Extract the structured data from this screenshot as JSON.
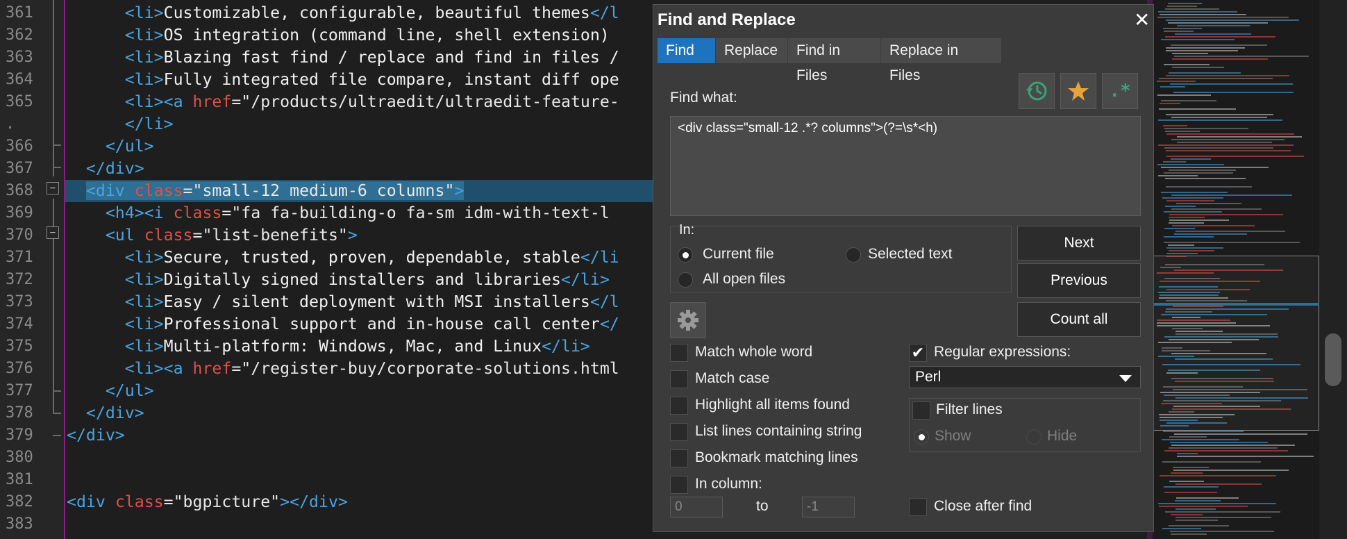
{
  "editor": {
    "line_numbers": [
      "361",
      "362",
      "363",
      "364",
      "365",
      ".",
      "366",
      "367",
      "368",
      "369",
      "370",
      "371",
      "372",
      "373",
      "374",
      "375",
      "376",
      "377",
      "378",
      "379",
      "380",
      "381",
      "382",
      "383"
    ],
    "lines": [
      {
        "num": "361",
        "segments": [
          {
            "t": "      ",
            "c": "txt"
          },
          {
            "t": "<li>",
            "c": "tag"
          },
          {
            "t": "Customizable, configurable, beautiful themes",
            "c": "txt"
          },
          {
            "t": "</l",
            "c": "tag"
          }
        ]
      },
      {
        "num": "362",
        "segments": [
          {
            "t": "      ",
            "c": "txt"
          },
          {
            "t": "<li>",
            "c": "tag"
          },
          {
            "t": "OS integration (command line, shell extension)",
            "c": "txt"
          }
        ]
      },
      {
        "num": "363",
        "segments": [
          {
            "t": "      ",
            "c": "txt"
          },
          {
            "t": "<li>",
            "c": "tag"
          },
          {
            "t": "Blazing fast find / replace and find in files /",
            "c": "txt"
          }
        ]
      },
      {
        "num": "364",
        "segments": [
          {
            "t": "      ",
            "c": "txt"
          },
          {
            "t": "<li>",
            "c": "tag"
          },
          {
            "t": "Fully integrated file compare, instant diff ope",
            "c": "txt"
          }
        ]
      },
      {
        "num": "365",
        "segments": [
          {
            "t": "      ",
            "c": "txt"
          },
          {
            "t": "<li><a ",
            "c": "tag"
          },
          {
            "t": "href",
            "c": "attr"
          },
          {
            "t": "=\"/products/ultraedit/ultraedit-feature-",
            "c": "str"
          }
        ]
      },
      {
        "num": ".",
        "segments": [
          {
            "t": "      ",
            "c": "txt"
          },
          {
            "t": "</li>",
            "c": "tag"
          }
        ]
      },
      {
        "num": "366",
        "segments": [
          {
            "t": "    ",
            "c": "txt"
          },
          {
            "t": "</ul>",
            "c": "tag"
          }
        ]
      },
      {
        "num": "367",
        "segments": [
          {
            "t": "  ",
            "c": "txt"
          },
          {
            "t": "</div>",
            "c": "tag"
          }
        ]
      },
      {
        "num": "368",
        "segments": [
          {
            "t": "  ",
            "c": "txt"
          },
          {
            "t": "<div ",
            "c": "tag sel"
          },
          {
            "t": "class",
            "c": "attr sel"
          },
          {
            "t": "=\"small-12 medium-6 columns\"",
            "c": "str sel"
          },
          {
            "t": ">",
            "c": "tag sel"
          }
        ]
      },
      {
        "num": "369",
        "segments": [
          {
            "t": "    ",
            "c": "txt"
          },
          {
            "t": "<h4><i ",
            "c": "tag"
          },
          {
            "t": "class",
            "c": "attr"
          },
          {
            "t": "=\"fa fa-building-o fa-sm idm-with-text-l",
            "c": "str"
          }
        ]
      },
      {
        "num": "370",
        "segments": [
          {
            "t": "    ",
            "c": "txt"
          },
          {
            "t": "<ul ",
            "c": "tag"
          },
          {
            "t": "class",
            "c": "attr"
          },
          {
            "t": "=\"list-benefits\"",
            "c": "str"
          },
          {
            "t": ">",
            "c": "tag"
          }
        ]
      },
      {
        "num": "371",
        "segments": [
          {
            "t": "      ",
            "c": "txt"
          },
          {
            "t": "<li>",
            "c": "tag"
          },
          {
            "t": "Secure, trusted, proven, dependable, stable",
            "c": "txt"
          },
          {
            "t": "</li",
            "c": "tag"
          }
        ]
      },
      {
        "num": "372",
        "segments": [
          {
            "t": "      ",
            "c": "txt"
          },
          {
            "t": "<li>",
            "c": "tag"
          },
          {
            "t": "Digitally signed installers and libraries",
            "c": "txt"
          },
          {
            "t": "</li>",
            "c": "tag"
          }
        ]
      },
      {
        "num": "373",
        "segments": [
          {
            "t": "      ",
            "c": "txt"
          },
          {
            "t": "<li>",
            "c": "tag"
          },
          {
            "t": "Easy / silent deployment with MSI installers",
            "c": "txt"
          },
          {
            "t": "</l",
            "c": "tag"
          }
        ]
      },
      {
        "num": "374",
        "segments": [
          {
            "t": "      ",
            "c": "txt"
          },
          {
            "t": "<li>",
            "c": "tag"
          },
          {
            "t": "Professional support and in-house call center",
            "c": "txt"
          },
          {
            "t": "</",
            "c": "tag"
          }
        ]
      },
      {
        "num": "375",
        "segments": [
          {
            "t": "      ",
            "c": "txt"
          },
          {
            "t": "<li>",
            "c": "tag"
          },
          {
            "t": "Multi-platform: Windows, Mac, and Linux",
            "c": "txt"
          },
          {
            "t": "</li>",
            "c": "tag"
          }
        ]
      },
      {
        "num": "376",
        "segments": [
          {
            "t": "      ",
            "c": "txt"
          },
          {
            "t": "<li><a ",
            "c": "tag"
          },
          {
            "t": "href",
            "c": "attr"
          },
          {
            "t": "=\"/register-buy/corporate-solutions.html",
            "c": "str"
          }
        ]
      },
      {
        "num": "377",
        "segments": [
          {
            "t": "    ",
            "c": "txt"
          },
          {
            "t": "</ul>",
            "c": "tag"
          }
        ]
      },
      {
        "num": "378",
        "segments": [
          {
            "t": "  ",
            "c": "txt"
          },
          {
            "t": "</div>",
            "c": "tag"
          }
        ]
      },
      {
        "num": "379",
        "segments": [
          {
            "t": "</div>",
            "c": "tag"
          }
        ]
      },
      {
        "num": "380",
        "segments": []
      },
      {
        "num": "381",
        "segments": []
      },
      {
        "num": "382",
        "segments": [
          {
            "t": "<div ",
            "c": "tag"
          },
          {
            "t": "class",
            "c": "attr"
          },
          {
            "t": "=\"bgpicture\"",
            "c": "str"
          },
          {
            "t": "></div>",
            "c": "tag"
          }
        ]
      },
      {
        "num": "383",
        "segments": []
      }
    ]
  },
  "dialog": {
    "title": "Find and Replace",
    "close_glyph": "✕",
    "tabs": [
      "Find",
      "Replace",
      "Find in Files",
      "Replace in Files"
    ],
    "find_what_label": "Find what:",
    "find_what_value": "<div class=\"small-12 .*? columns\">(?=\\s*<h)",
    "regex_button_glyph": ".*",
    "in_label": "In:",
    "scope": {
      "current_file": "Current file",
      "selected_text": "Selected text",
      "all_open_files": "All open files",
      "selected": "current_file"
    },
    "buttons": {
      "next": "Next",
      "previous": "Previous",
      "count_all": "Count all"
    },
    "options": {
      "match_whole_word": {
        "label": "Match whole word",
        "checked": false
      },
      "match_case": {
        "label": "Match case",
        "checked": false
      },
      "highlight_all": {
        "label": "Highlight all items found",
        "checked": false
      },
      "list_lines": {
        "label": "List lines containing string",
        "checked": false
      },
      "bookmark_lines": {
        "label": "Bookmark matching lines",
        "checked": false
      },
      "in_column": {
        "label": "In column:",
        "checked": false
      },
      "regular_expressions": {
        "label": "Regular expressions:",
        "checked": true
      },
      "filter_lines": {
        "label": "Filter lines",
        "checked": false
      },
      "close_after_find": {
        "label": "Close after find",
        "checked": false
      }
    },
    "regex_engine": "Perl",
    "filter_show": "Show",
    "filter_hide": "Hide",
    "column_from": "0",
    "column_to_label": "to",
    "column_to": "-1",
    "colors": {
      "accent": "#1e73be",
      "star": "#e8a33a",
      "history": "#3aa37a",
      "regex": "#3aa37a"
    }
  }
}
